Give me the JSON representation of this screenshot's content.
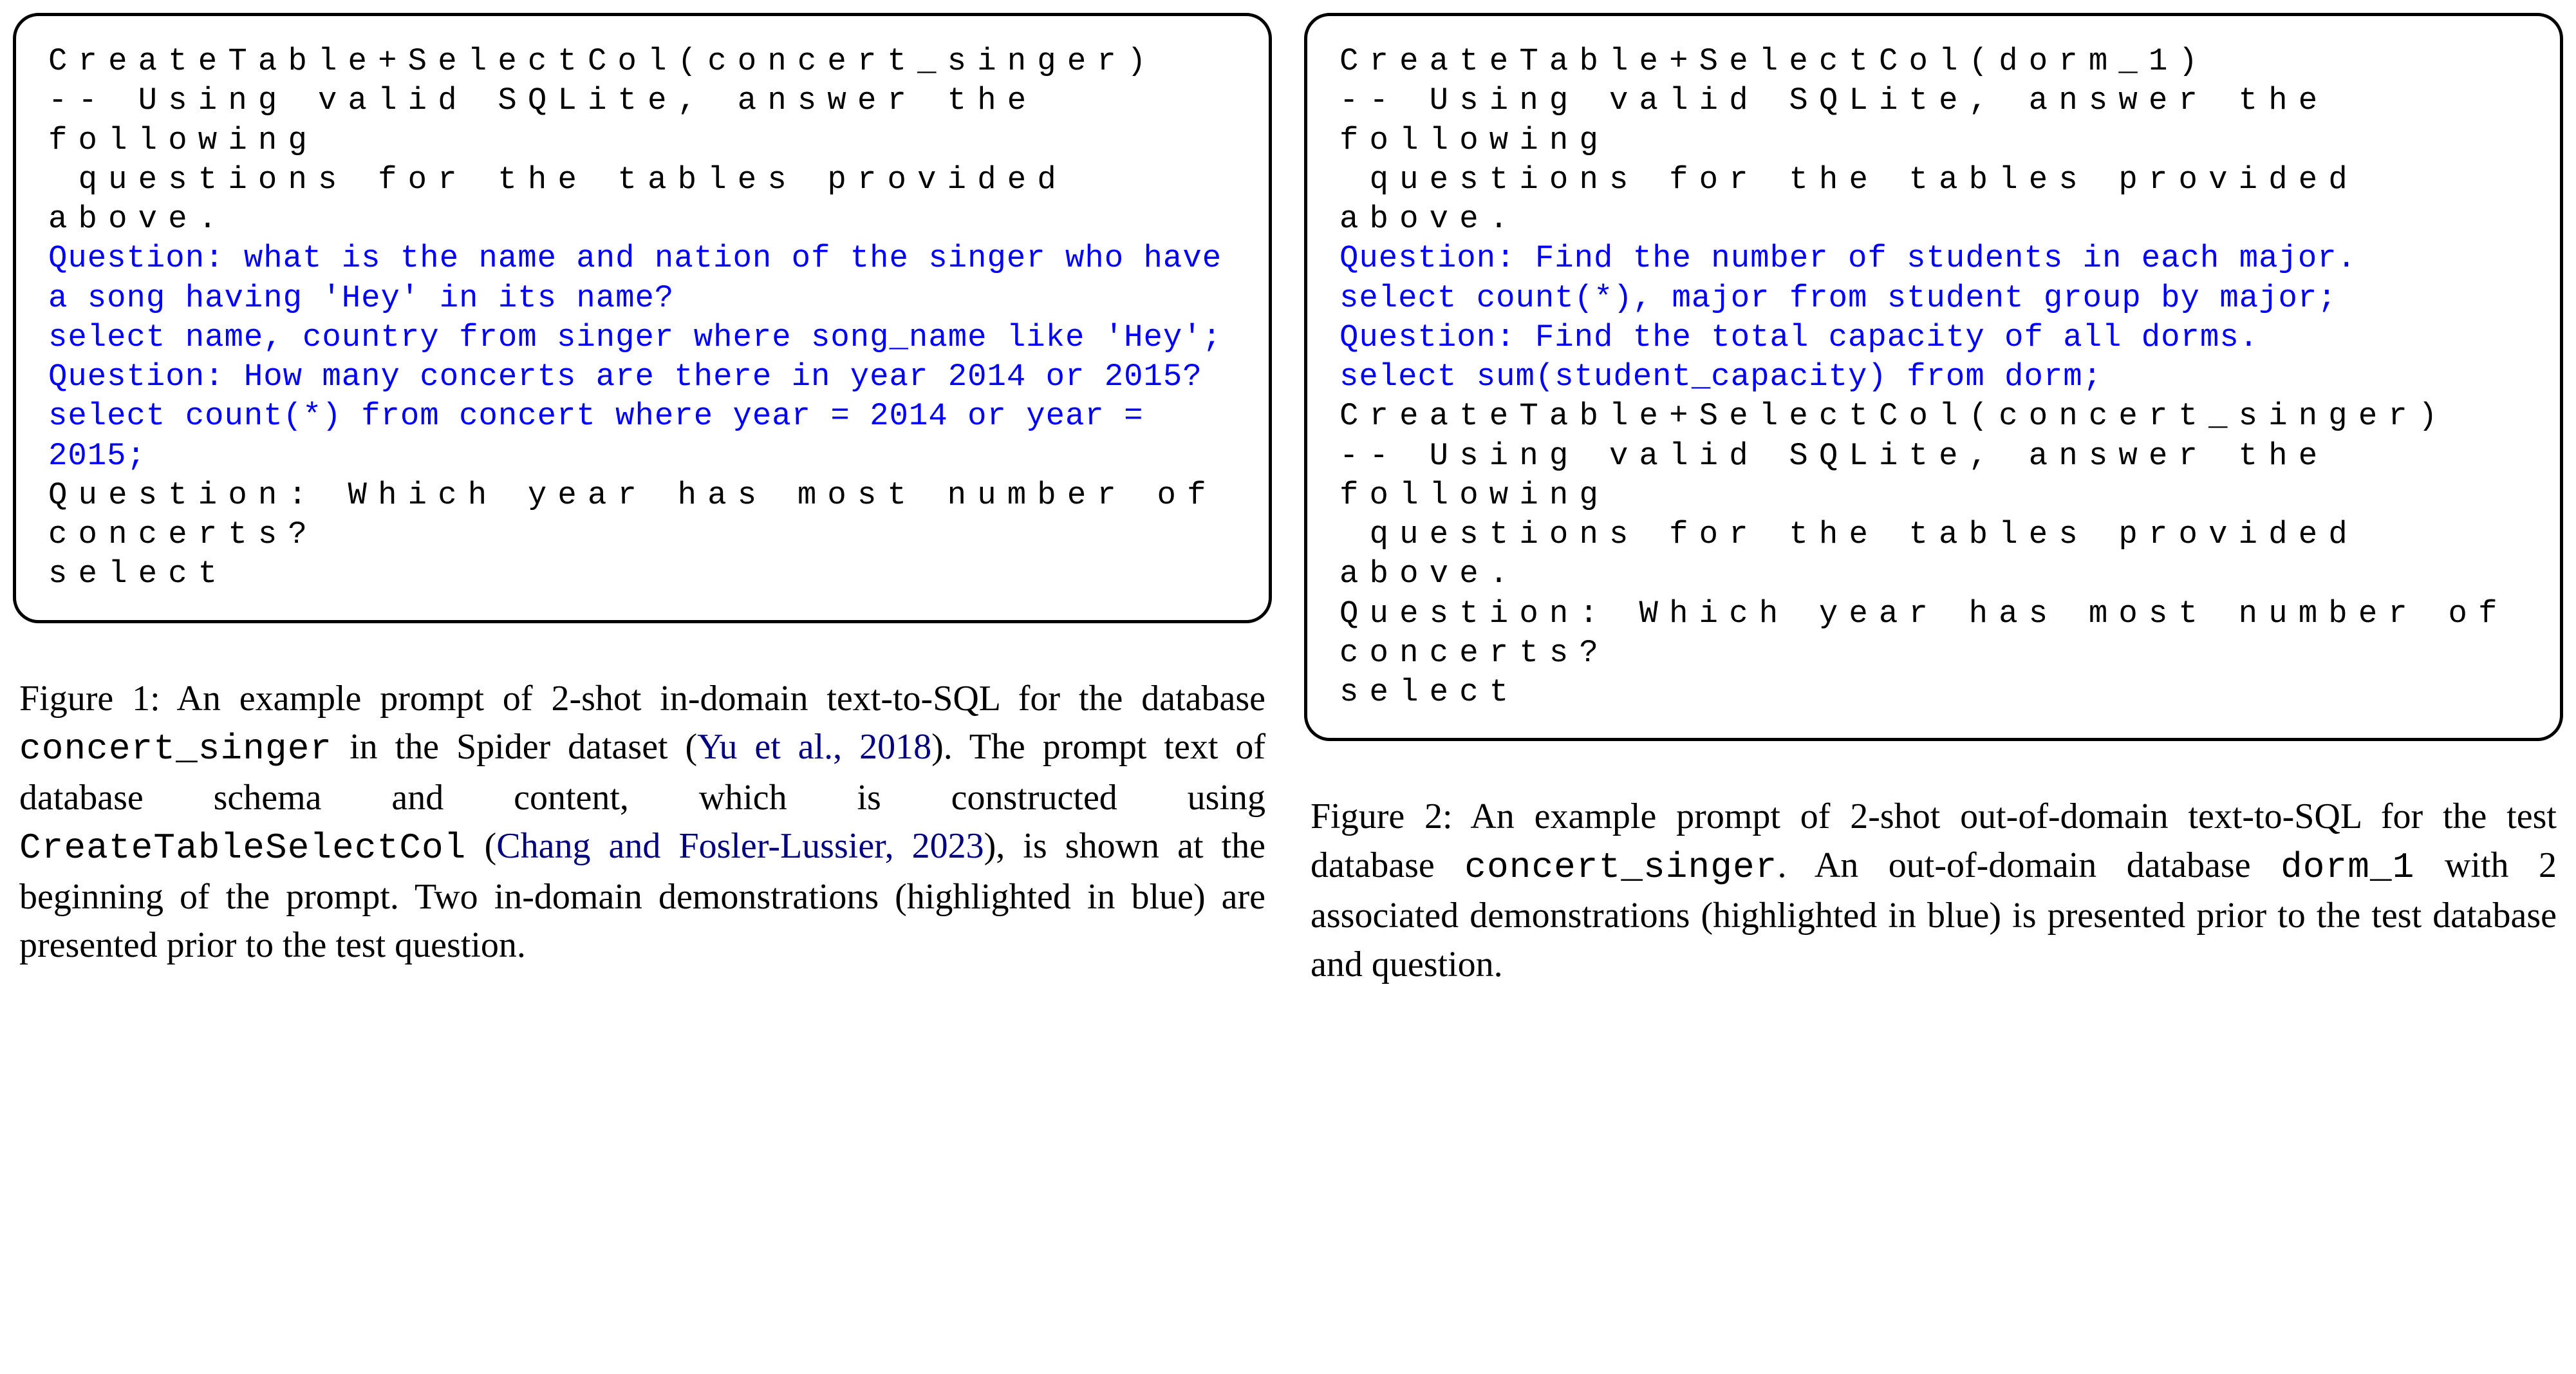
{
  "figure1": {
    "code": {
      "line1": "CreateTable+SelectCol(concert_singer)",
      "line2": "",
      "line3": "-- Using valid SQLite, answer the following",
      "line4": " questions for the tables provided above.",
      "line5": "Question: what is the name and nation of the singer who have a song having 'Hey' in its name?",
      "line6": "select name, country from singer where song_name like 'Hey';",
      "line7": "Question: How many concerts are there in year 2014 or 2015?",
      "line8": "select count(*) from concert where year = 2014 or year = 2015;",
      "line9": "Question: Which year has most number of concerts?",
      "line10": "select"
    },
    "caption": {
      "prefix": "Figure 1:  An example prompt of 2-shot in-domain text-to-SQL for the database ",
      "db1": "concert_singer",
      "mid1": " in the Spider dataset (",
      "cite1": "Yu et al., 2018",
      "mid2": "). The prompt text of database schema and content, which is constructed using ",
      "method": "CreateTableSelectCol",
      "mid3": " (",
      "cite2": "Chang and Fosler-Lussier, 2023",
      "mid4": "), is shown at the beginning of the prompt. Two in-domain demonstrations (highlighted in blue) are presented prior to the test question."
    }
  },
  "figure2": {
    "code": {
      "line1": "CreateTable+SelectCol(dorm_1)",
      "line2": "",
      "line3": "-- Using valid SQLite, answer the following",
      "line4": " questions for the tables provided above.",
      "line5": "Question: Find the number of students in each major.",
      "line6": "select count(*), major from student group by major;",
      "line7": "Question: Find the total capacity of all dorms.",
      "line8": "select sum(student_capacity) from dorm;",
      "line9": "",
      "line10": "CreateTable+SelectCol(concert_singer)",
      "line11": "",
      "line12": "-- Using valid SQLite, answer the following",
      "line13": " questions for the tables provided above.",
      "line14": "Question: Which year has most number of concerts?",
      "line15": "select"
    },
    "caption": {
      "prefix": "Figure 2: An example prompt of 2-shot out-of-domain text-to-SQL for the test database ",
      "db1": "concert_singer",
      "mid1": ". An out-of-domain database ",
      "db2": "dorm_1",
      "mid2": " with 2 associated demonstrations (highlighted in blue) is presented prior to the test database and question."
    }
  }
}
